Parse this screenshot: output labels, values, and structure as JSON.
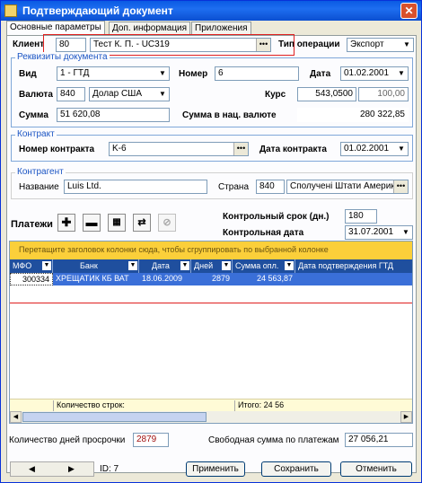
{
  "window": {
    "title": "Подтверждающий документ",
    "close_label": "✕"
  },
  "tabs": [
    "Основные параметры",
    "Доп. информация",
    "Приложения"
  ],
  "header": {
    "client_label": "Клиент",
    "client_code": "80",
    "client_name": "Тест К. П. - UC319",
    "op_type_label": "Тип операции",
    "op_type_value": "Экспорт"
  },
  "doc_group": {
    "title": "Реквизиты документа",
    "type_label": "Вид",
    "type_value": "1 - ГТД",
    "number_label": "Номер",
    "number_value": "6",
    "date_label": "Дата",
    "date_value": "01.02.2001",
    "currency_label": "Валюта",
    "currency_code": "840",
    "currency_name": "Долар США",
    "rate_label": "Курс",
    "rate_value": "543,0500",
    "rate_scale": "100,00",
    "sum_label": "Сумма",
    "sum_value": "51 620,08",
    "sum_nat_label": "Сумма в нац. валюте",
    "sum_nat_value": "280 322,85"
  },
  "contract_group": {
    "title": "Контракт",
    "number_label": "Номер контракта",
    "number_value": "K-6",
    "date_label": "Дата контракта",
    "date_value": "01.02.2001"
  },
  "counterparty_group": {
    "title": "Контрагент",
    "name_label": "Название",
    "name_value": "Luis Ltd.",
    "country_label": "Страна",
    "country_code": "840",
    "country_name": "Сполучені Штати Америки"
  },
  "payments": {
    "label": "Платежи",
    "control_term_label": "Контрольный срок (дн.)",
    "control_term_value": "180",
    "control_date_label": "Контрольная дата",
    "control_date_value": "31.07.2001"
  },
  "grid": {
    "hint": "Перетащите заголовок колонки сюда, чтобы сгруппировать по выбранной колонке",
    "columns": [
      "МФО",
      "Банк",
      "Дата",
      "Дней",
      "Сумма опл.",
      "Дата подтверждения ГТД"
    ],
    "rows": [
      [
        "300334",
        "ХРЕЩАТИК КБ ВАТ",
        "18.06.2009",
        "2879",
        "24 563,87",
        ""
      ]
    ],
    "footer_count": "Количество строк:",
    "footer_total": "Итого: 24 56"
  },
  "bottom": {
    "overdue_label": "Количество дней просрочки",
    "overdue_value": "2879",
    "free_sum_label": "Свободная сумма по платежам",
    "free_sum_value": "27 056,21",
    "id_label": "ID: 7",
    "apply_label": "Применить",
    "save_label": "Сохранить",
    "cancel_label": "Отменить"
  }
}
